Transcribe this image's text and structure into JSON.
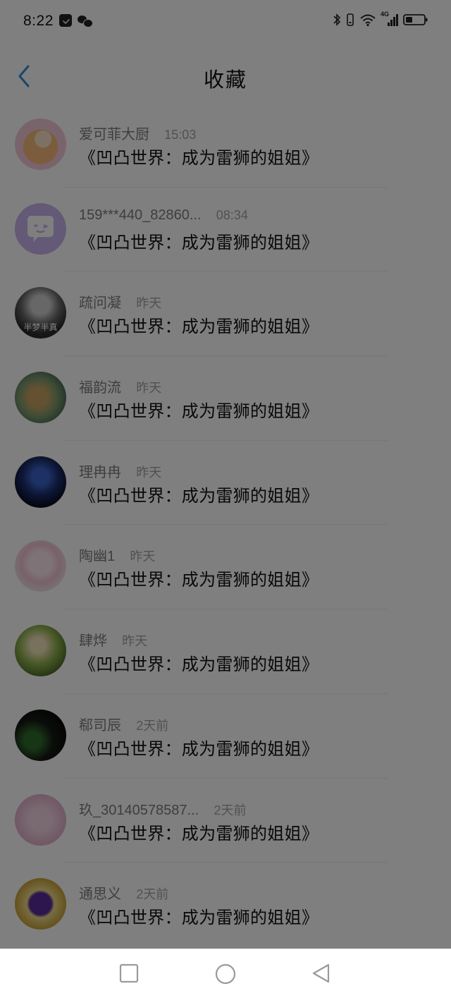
{
  "status_bar": {
    "time": "8:22",
    "left_icons": [
      "notification-icon",
      "wechat-icon"
    ],
    "right_icons": [
      "bluetooth-icon",
      "vibrate-icon",
      "wifi-icon",
      "signal-4g-icon",
      "battery-icon"
    ],
    "network_label": "4G"
  },
  "header": {
    "title": "收藏",
    "back_icon": "chevron-left-icon",
    "accent_color": "#2b8ed8"
  },
  "favorites": [
    {
      "name": "爱可菲大厨",
      "time": "15:03",
      "content": "《凹凸世界：成为雷狮的姐姐》"
    },
    {
      "name": "159***440_82860...",
      "time": "08:34",
      "content": "《凹凸世界：成为雷狮的姐姐》"
    },
    {
      "name": "疏问凝",
      "time": "昨天",
      "content": "《凹凸世界：成为雷狮的姐姐》"
    },
    {
      "name": "福韵流",
      "time": "昨天",
      "content": "《凹凸世界：成为雷狮的姐姐》"
    },
    {
      "name": "理冉冉",
      "time": "昨天",
      "content": "《凹凸世界：成为雷狮的姐姐》"
    },
    {
      "name": "陶幽1",
      "time": "昨天",
      "content": "《凹凸世界：成为雷狮的姐姐》"
    },
    {
      "name": "肆烨",
      "time": "昨天",
      "content": "《凹凸世界：成为雷狮的姐姐》"
    },
    {
      "name": "郗司辰",
      "time": "2天前",
      "content": "《凹凸世界：成为雷狮的姐姐》"
    },
    {
      "name": "玖_30140578587...",
      "time": "2天前",
      "content": "《凹凸世界：成为雷狮的姐姐》"
    },
    {
      "name": "通思义",
      "time": "2天前",
      "content": "《凹凸世界：成为雷狮的姐姐》"
    }
  ],
  "avatar_labels": {
    "avatar_3_text": "半梦半真"
  },
  "nav_bar": {
    "icons": [
      "recent-apps-icon",
      "home-icon",
      "back-icon"
    ]
  }
}
